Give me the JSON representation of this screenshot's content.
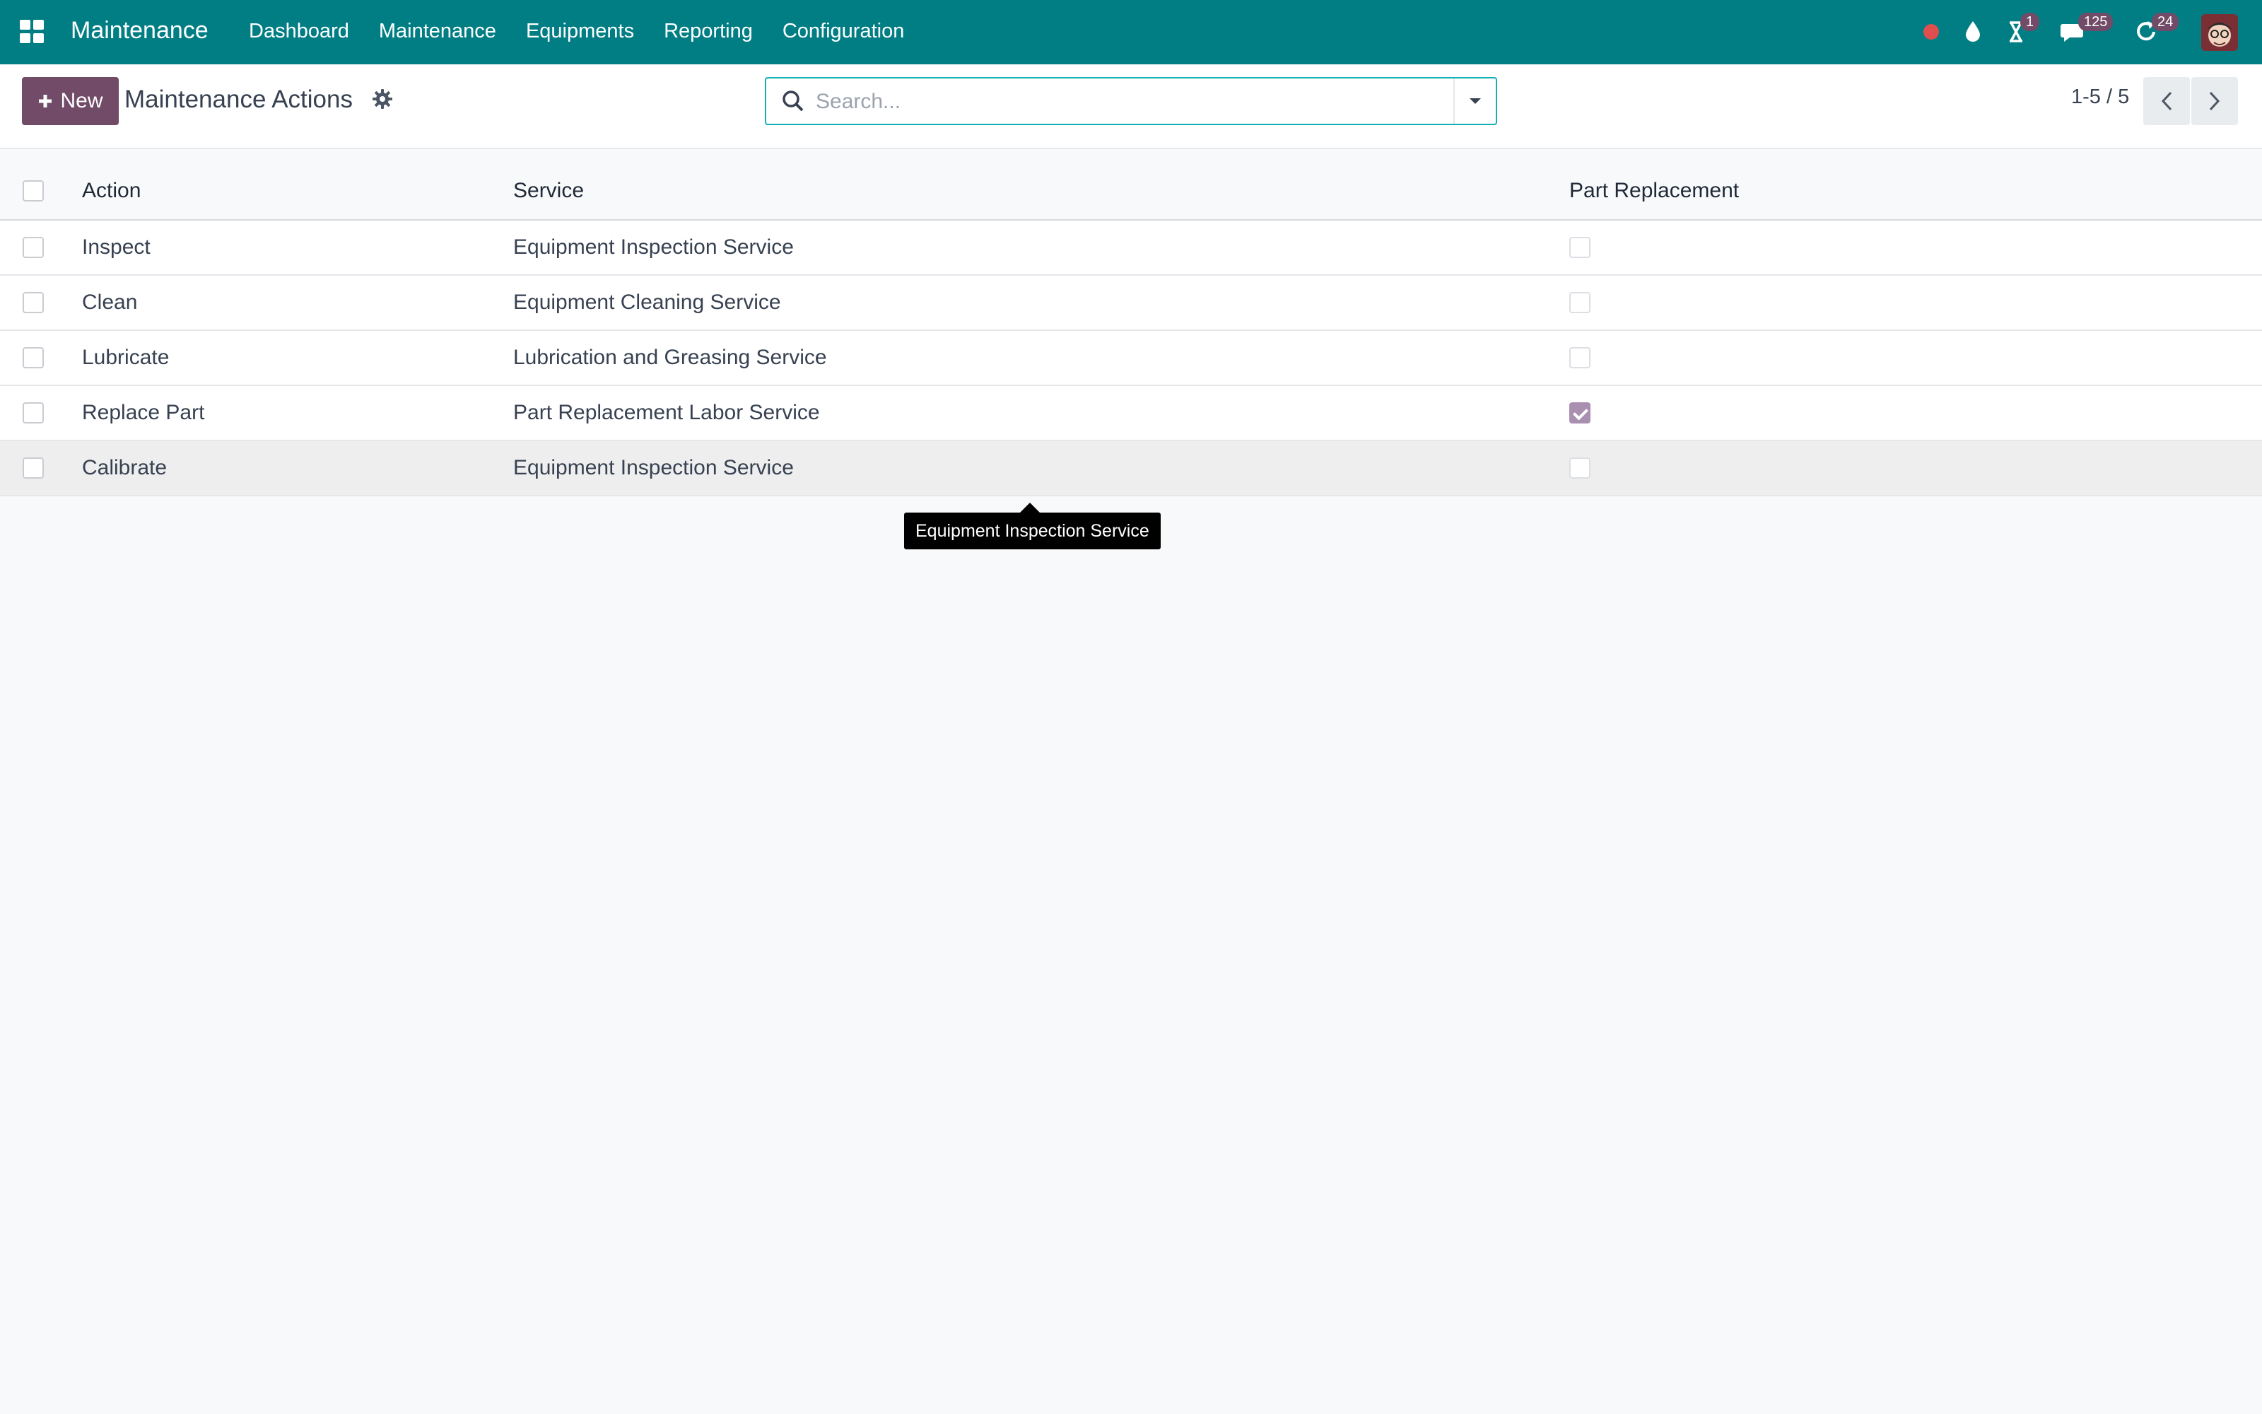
{
  "navbar": {
    "app_name": "Maintenance",
    "menu": [
      "Dashboard",
      "Maintenance",
      "Equipments",
      "Reporting",
      "Configuration"
    ],
    "systray": {
      "activity_badge": "1",
      "messages_badge": "125",
      "updates_badge": "24"
    },
    "colors": {
      "bar": "#017e84",
      "record": "#e04e4e",
      "badge": "#714b67"
    }
  },
  "control": {
    "new_label": "New",
    "title": "Maintenance Actions",
    "search_placeholder": "Search...",
    "pager": "1-5 / 5"
  },
  "table": {
    "columns": {
      "action": "Action",
      "service": "Service",
      "part_replacement": "Part Replacement"
    },
    "rows": [
      {
        "action": "Inspect",
        "service": "Equipment Inspection Service",
        "part_replacement": false
      },
      {
        "action": "Clean",
        "service": "Equipment Cleaning Service",
        "part_replacement": false
      },
      {
        "action": "Lubricate",
        "service": "Lubrication and Greasing Service",
        "part_replacement": false
      },
      {
        "action": "Replace Part",
        "service": "Part Replacement Labor Service",
        "part_replacement": true
      },
      {
        "action": "Calibrate",
        "service": "Equipment Inspection Service",
        "part_replacement": false
      }
    ]
  },
  "tooltip": {
    "text": "Equipment Inspection Service"
  },
  "theme": {
    "primary": "#714b67",
    "accent": "#12b1b9"
  }
}
